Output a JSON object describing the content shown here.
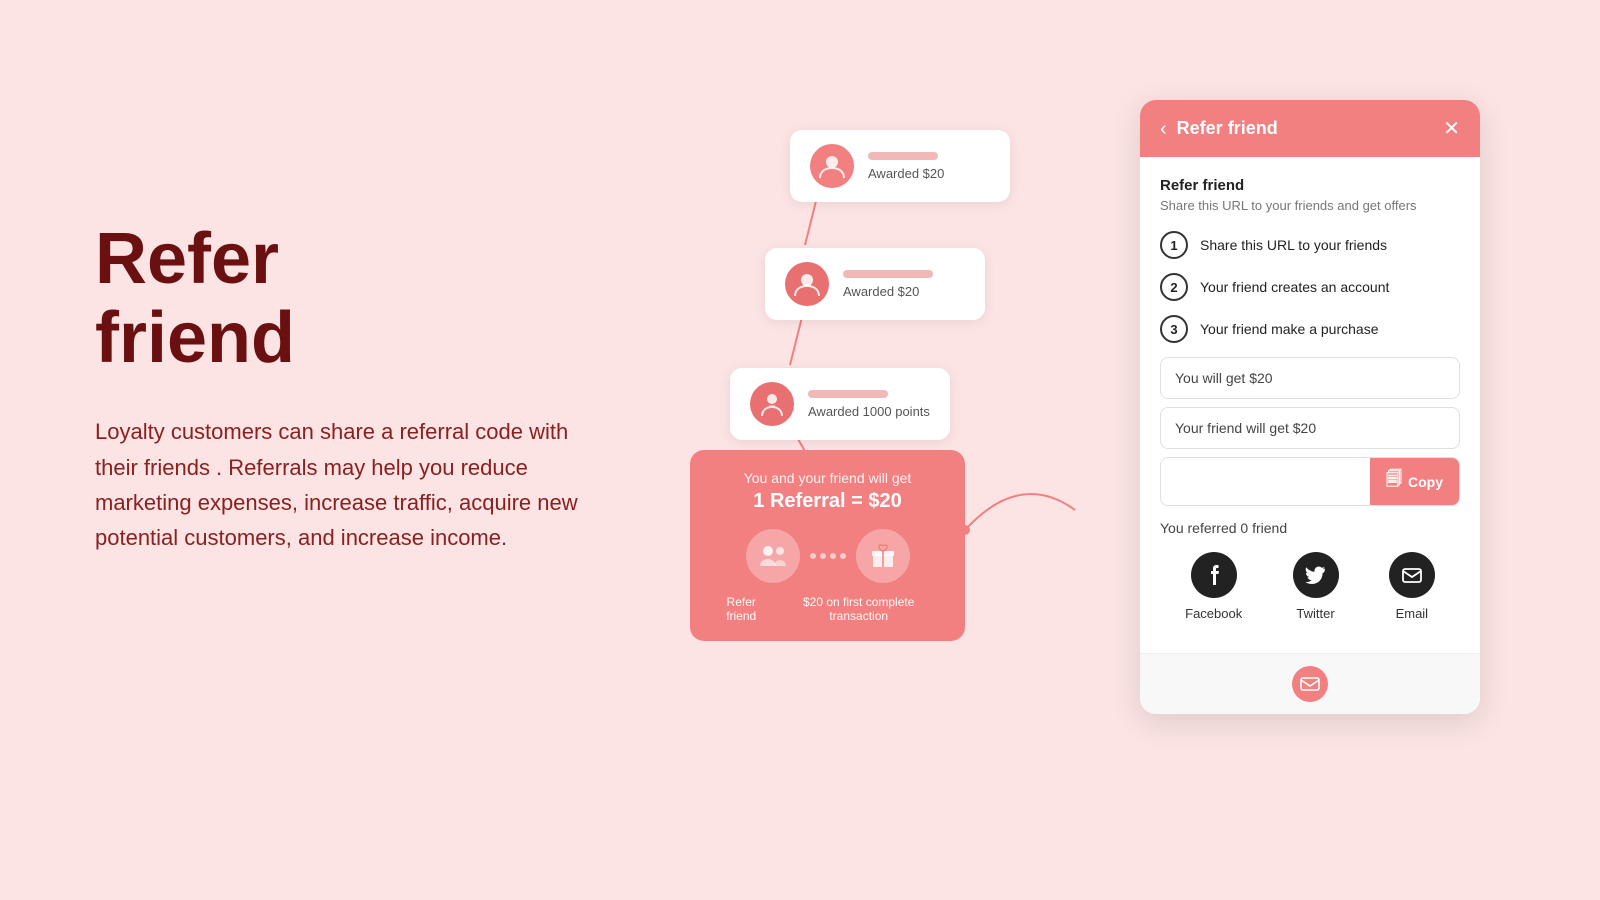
{
  "page": {
    "background": "#fce4e4"
  },
  "left": {
    "title_line1": "Refer",
    "title_line2": "friend",
    "description": "Loyalty customers can share a referral code with their friends . Referrals may help you reduce marketing expenses, increase traffic, acquire new potential customers, and increase income."
  },
  "diagram": {
    "cards": [
      {
        "award": "Awarded $20"
      },
      {
        "award": "Awarded $20"
      },
      {
        "award": "Awarded 1000 points"
      }
    ],
    "referral_card": {
      "title": "You and your friend will get",
      "amount": "1 Referral = $20",
      "label1": "Refer friend",
      "label2": "$20 on first complete transaction"
    }
  },
  "panel": {
    "header_title": "Refer friend",
    "subtitle_title": "Refer friend",
    "subtitle_desc": "Share this URL to your friends and get offers",
    "steps": [
      {
        "number": "1",
        "text": "Share this URL to your friends"
      },
      {
        "number": "2",
        "text": "Your friend creates an account"
      },
      {
        "number": "3",
        "text": "Your friend make a purchase"
      }
    ],
    "reward_you": "You will get $20",
    "reward_friend": "Your friend will get $20",
    "copy_placeholder": "",
    "copy_label": "Copy",
    "referred_text": "You referred 0 friend",
    "social": [
      {
        "name": "Facebook",
        "icon": "facebook"
      },
      {
        "name": "Twitter",
        "icon": "twitter"
      },
      {
        "name": "Email",
        "icon": "email"
      }
    ],
    "back_label": "‹",
    "close_label": "✕"
  }
}
